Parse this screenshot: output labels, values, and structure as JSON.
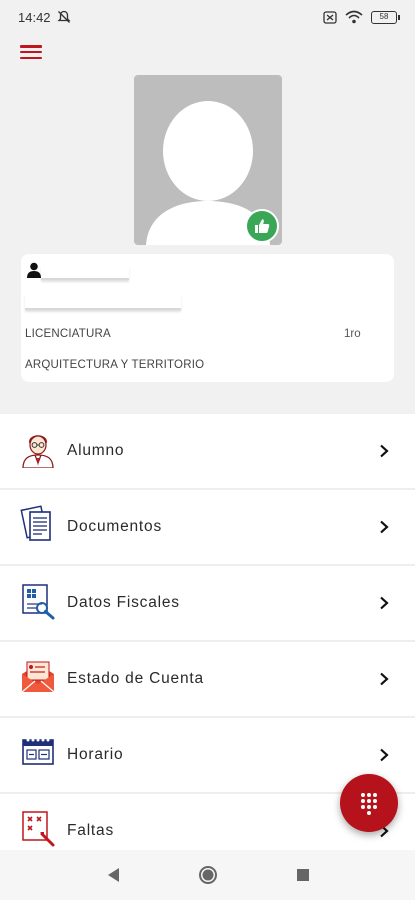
{
  "status_bar": {
    "time": "14:42",
    "battery": "58"
  },
  "header": {
    "menu_icon": "hamburger-icon",
    "accent_color": "#c0161f"
  },
  "profile": {
    "avatar_icon": "avatar-placeholder-icon",
    "badge_icon": "thumbs-up-icon",
    "badge_color": "#3aa757",
    "degree": "LICENCIATURA",
    "semester": "1ro",
    "career": "ARQUITECTURA Y TERRITORIO"
  },
  "menu": {
    "items": [
      {
        "label": "Alumno",
        "icon": "student-icon"
      },
      {
        "label": "Documentos",
        "icon": "documents-icon"
      },
      {
        "label": "Datos Fiscales",
        "icon": "tax-data-icon"
      },
      {
        "label": "Estado de Cuenta",
        "icon": "account-statement-icon"
      },
      {
        "label": "Horario",
        "icon": "calendar-icon"
      },
      {
        "label": "Faltas",
        "icon": "absences-icon"
      }
    ]
  },
  "fab": {
    "icon": "dialpad-icon",
    "color": "#b5121b"
  },
  "nav_bar": {
    "back": "back-icon",
    "home": "home-icon",
    "recents": "recents-icon"
  }
}
